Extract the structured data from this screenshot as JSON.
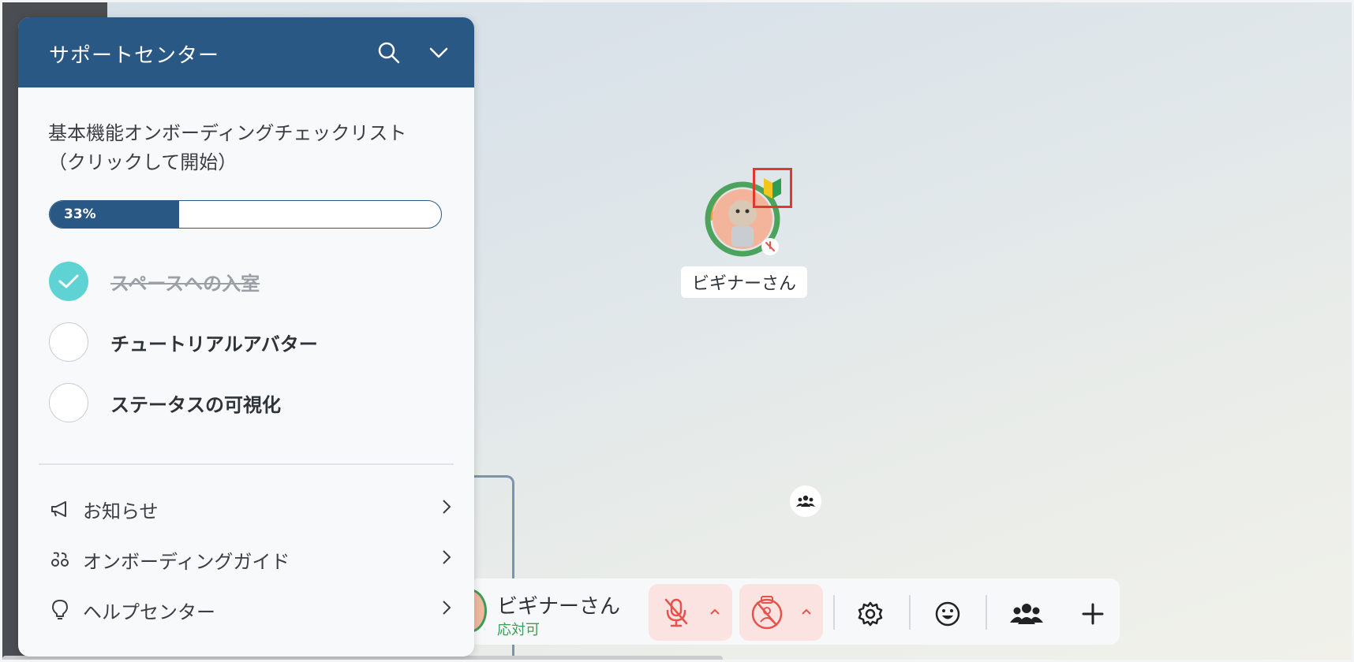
{
  "support_center": {
    "title": "サポートセンター",
    "checklist_title": "基本機能オンボーディングチェックリスト（クリックして開始）",
    "progress": {
      "label": "33%",
      "fraction": 0.33
    },
    "tasks": [
      {
        "label": "スペースへの入室",
        "done": true
      },
      {
        "label": "チュートリアルアバター",
        "done": false
      },
      {
        "label": "ステータスの可視化",
        "done": false
      }
    ],
    "menu": [
      {
        "label": "お知らせ",
        "icon": "megaphone-icon"
      },
      {
        "label": "オンボーディングガイド",
        "icon": "onboarding-icon"
      },
      {
        "label": "ヘルプセンター",
        "icon": "lightbulb-icon"
      }
    ]
  },
  "space": {
    "avatar_name": "ビギナーさん"
  },
  "control_bar": {
    "user_name": "ビギナーさん",
    "user_status": "応対可"
  },
  "colors": {
    "header_blue": "#2a5885",
    "check_teal": "#5fd3d4",
    "status_green": "#3e9c57",
    "mute_red": "#e5534b",
    "highlight_red": "#e03a2a"
  }
}
